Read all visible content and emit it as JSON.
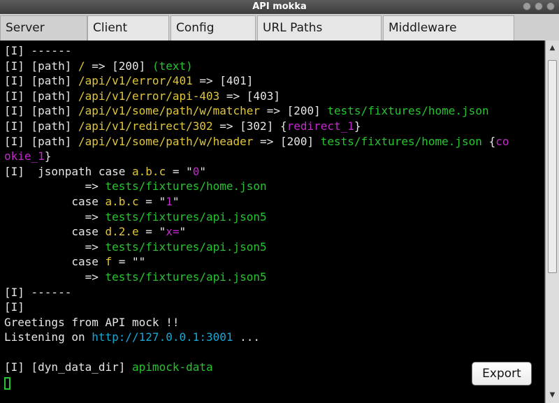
{
  "window": {
    "title": "API mokka"
  },
  "tabs": [
    "Server",
    "Client",
    "Config",
    "URL Paths",
    "Middleware"
  ],
  "console": {
    "lines": [
      [
        [
          "w",
          "[I] ------"
        ]
      ],
      [
        [
          "w",
          "[I] [path] "
        ],
        [
          "y",
          "/"
        ],
        [
          "w",
          " => [200] "
        ],
        [
          "g",
          "(text)"
        ]
      ],
      [
        [
          "w",
          "[I] [path] "
        ],
        [
          "y",
          "/api/v1/error/401"
        ],
        [
          "w",
          " => [401]"
        ]
      ],
      [
        [
          "w",
          "[I] [path] "
        ],
        [
          "y",
          "/api/v1/error/api-403"
        ],
        [
          "w",
          " => [403]"
        ]
      ],
      [
        [
          "w",
          "[I] [path] "
        ],
        [
          "y",
          "/api/v1/some/path/w/matcher"
        ],
        [
          "w",
          " => [200] "
        ],
        [
          "g",
          "tests/fixtures/home.json"
        ]
      ],
      [
        [
          "w",
          "[I] [path] "
        ],
        [
          "y",
          "/api/v1/redirect/302"
        ],
        [
          "w",
          " => [302] {"
        ],
        [
          "m",
          "redirect_1"
        ],
        [
          "w",
          "}"
        ]
      ],
      [
        [
          "w",
          "[I] [path] "
        ],
        [
          "y",
          "/api/v1/some/path/w/header"
        ],
        [
          "w",
          " => [200] "
        ],
        [
          "g",
          "tests/fixtures/home.json"
        ],
        [
          "w",
          " {"
        ],
        [
          "m",
          "co"
        ]
      ],
      [
        [
          "m",
          "okie_1"
        ],
        [
          "w",
          "}"
        ]
      ],
      [
        [
          "w",
          "[I]  jsonpath case "
        ],
        [
          "y",
          "a.b.c"
        ],
        [
          "w",
          " = \""
        ],
        [
          "m",
          "0"
        ],
        [
          "w",
          "\""
        ]
      ],
      [
        [
          "w",
          "            => "
        ],
        [
          "g",
          "tests/fixtures/home.json"
        ]
      ],
      [
        [
          "w",
          "          case "
        ],
        [
          "y",
          "a.b.c"
        ],
        [
          "w",
          " = \""
        ],
        [
          "m",
          "1"
        ],
        [
          "w",
          "\""
        ]
      ],
      [
        [
          "w",
          "            => "
        ],
        [
          "g",
          "tests/fixtures/api.json5"
        ]
      ],
      [
        [
          "w",
          "          case "
        ],
        [
          "y",
          "d.2.e"
        ],
        [
          "w",
          " = \""
        ],
        [
          "m",
          "x="
        ],
        [
          "w",
          "\""
        ]
      ],
      [
        [
          "w",
          "            => "
        ],
        [
          "g",
          "tests/fixtures/api.json5"
        ]
      ],
      [
        [
          "w",
          "          case "
        ],
        [
          "y",
          "f"
        ],
        [
          "w",
          " = \"\""
        ]
      ],
      [
        [
          "w",
          "            => "
        ],
        [
          "g",
          "tests/fixtures/api.json5"
        ]
      ],
      [
        [
          "w",
          "[I] ------"
        ]
      ],
      [
        [
          "w",
          "[I]"
        ]
      ],
      [
        [
          "w",
          "Greetings from API mock !!"
        ]
      ],
      [
        [
          "w",
          "Listening on "
        ],
        [
          "c",
          "http://127.0.0.1:3001"
        ],
        [
          "w",
          " ..."
        ]
      ],
      [
        [
          "w",
          ""
        ]
      ],
      [
        [
          "w",
          "[I] [dyn_data_dir] "
        ],
        [
          "g",
          "apimock-data"
        ]
      ]
    ]
  },
  "export_button": {
    "label": "Export"
  },
  "colors": {
    "plain": "#e6e6e6",
    "path": "#e0c63a",
    "file": "#27c431",
    "key": "#c02bc9",
    "url": "#19a8d6",
    "background": "#000000"
  }
}
